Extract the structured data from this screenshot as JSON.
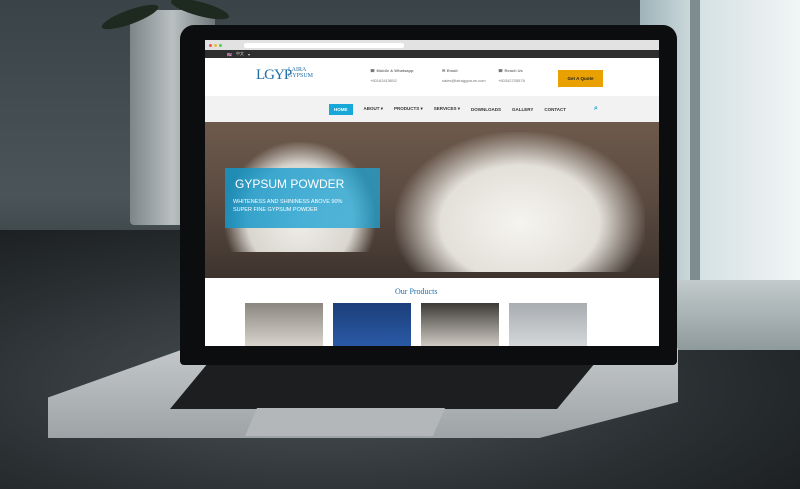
{
  "site": {
    "lang": "中文",
    "logo_mark": "LGYP",
    "logo_line1": "LAIRA",
    "logo_line2": "GYPSUM",
    "contact": [
      {
        "label": "Mobile & Whatsapp",
        "value": "+60163415652",
        "icon": "phone-icon"
      },
      {
        "label": "Email",
        "value": "sales@lairagypsum.com",
        "icon": "email-icon"
      },
      {
        "label": "Reach Us",
        "value": "+60342705578",
        "icon": "phone-icon"
      }
    ],
    "quote_button": "Get A Quote",
    "nav": [
      "HOME",
      "ABOUT",
      "PRODUCTS",
      "SERVICES",
      "DOWNLOADS",
      "GALLERY",
      "CONTACT"
    ],
    "hero_title": "GYPSUM POWDER",
    "hero_line1": "WHITENESS AND SHININESS ABOVE 90%",
    "hero_line2": "SUPER FINE GYPSUM POWDER",
    "products_heading": "Our Products"
  },
  "colors": {
    "accent": "#17a7d8",
    "quote": "#e8a100",
    "brand": "#1f6ea7"
  }
}
